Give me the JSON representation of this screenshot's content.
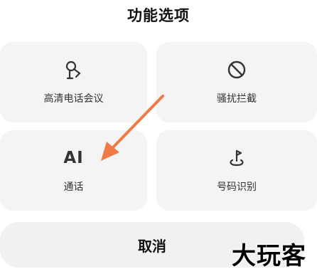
{
  "dialog": {
    "title": "功能选项",
    "options": [
      {
        "label": "高清电话会议",
        "icon": "conference-mic-icon"
      },
      {
        "label": "骚扰拦截",
        "icon": "block-icon"
      },
      {
        "label": "通话",
        "icon_text": "AI",
        "icon": "ai-icon"
      },
      {
        "label": "号码识别",
        "icon": "location-pin-icon"
      }
    ],
    "cancel_label": "取消"
  },
  "annotation": {
    "arrow_color": "#f07a45"
  },
  "watermark": {
    "text": "大玩客"
  }
}
